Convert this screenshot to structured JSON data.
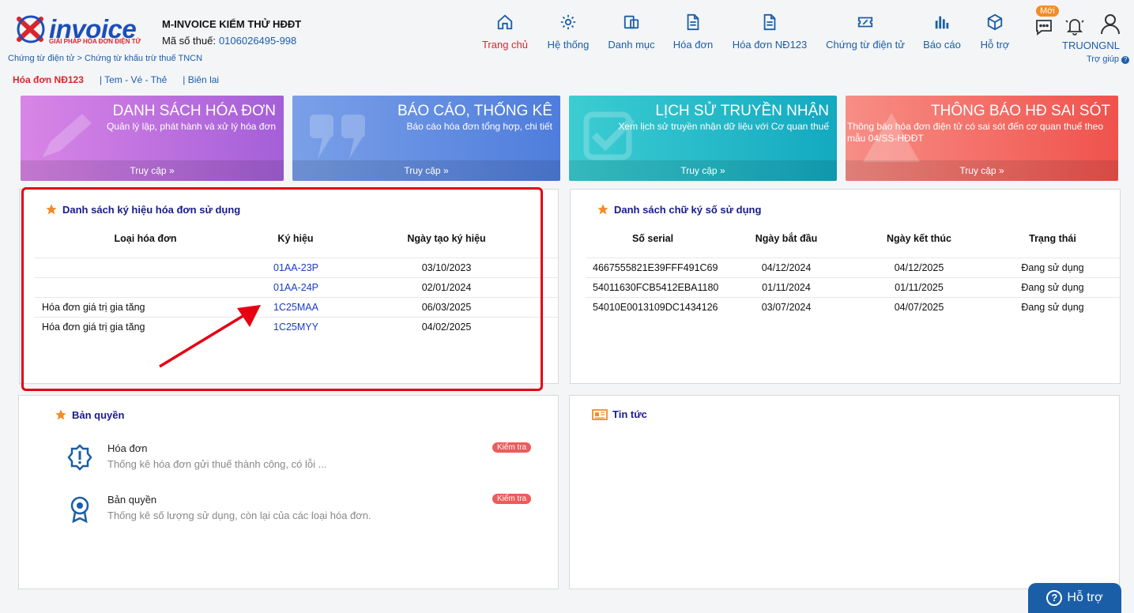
{
  "header": {
    "logo_text": "invoice",
    "logo_sub": "GIẢI PHÁP HÓA ĐƠN ĐIỆN TỬ",
    "company": "M-INVOICE KIỂM THỬ HĐĐT",
    "tax_label": "Mã số thuế:",
    "tax_value": "0106026495-998",
    "breadcrumb": "Chứng từ điện tử > Chứng từ khấu trừ thuế TNCN",
    "nav": [
      {
        "label": "Trang chủ",
        "icon": "home-icon"
      },
      {
        "label": "Hệ thống",
        "icon": "gear-icon"
      },
      {
        "label": "Danh mục",
        "icon": "folder-icon"
      },
      {
        "label": "Hóa đơn",
        "icon": "document-icon"
      },
      {
        "label": "Hóa đơn NĐ123",
        "icon": "document-icon"
      },
      {
        "label": "Chứng từ điện tử",
        "icon": "ticket-icon"
      },
      {
        "label": "Báo cáo",
        "icon": "bar-chart-icon"
      },
      {
        "label": "Hỗ trợ",
        "icon": "cube-icon"
      }
    ],
    "new_badge": "Mới",
    "username": "TRUONGNL",
    "help_link": "Trợ giúp"
  },
  "subnav": {
    "active": "Hóa đơn NĐ123",
    "items": [
      "| Tem - Vé - Thẻ",
      "| Biên lai"
    ]
  },
  "cards": [
    {
      "title": "DANH SÁCH HÓA ĐƠN",
      "desc": "Quản lý lập, phát hành và xử lý hóa đơn",
      "action": "Truy cập",
      "color": "#b26be0"
    },
    {
      "title": "BÁO CÁO, THỐNG KÊ",
      "desc": "Báo cáo hóa đơn tổng hợp, chi tiết",
      "action": "Truy cập",
      "color": "#5f8de2"
    },
    {
      "title": "LỊCH SỬ TRUYỀN NHẬN",
      "desc": "Xem lịch sử truyền nhận dữ liệu với Cơ quan thuế",
      "action": "Truy cập",
      "color": "#22b6c7"
    },
    {
      "title": "THÔNG BÁO HĐ SAI SÓT",
      "desc": "Thông báo hóa đơn điện tử có sai sót đến cơ quan thuế theo mẫu 04/SS-HĐĐT",
      "action": "Truy cập",
      "color": "#f26a64"
    }
  ],
  "symbols_panel": {
    "title": "Danh sách ký hiệu hóa đơn sử dụng",
    "columns": [
      "Loại hóa đơn",
      "Ký hiệu",
      "Ngày tạo ký hiệu"
    ],
    "rows": [
      {
        "type": "",
        "symbol": "01AA-23P",
        "date": "03/10/2023"
      },
      {
        "type": "",
        "symbol": "01AA-24P",
        "date": "02/01/2024"
      },
      {
        "type": "Hóa đơn giá trị gia tăng",
        "symbol": "1C25MAA",
        "date": "06/03/2025"
      },
      {
        "type": "Hóa đơn giá trị gia tăng",
        "symbol": "1C25MYY",
        "date": "04/02/2025"
      }
    ]
  },
  "signatures_panel": {
    "title": "Danh sách chữ ký số sử dụng",
    "columns": [
      "Số serial",
      "Ngày bắt đầu",
      "Ngày kết thúc",
      "Trạng thái"
    ],
    "rows": [
      {
        "serial": "4667555821E39FFF491C69",
        "start": "04/12/2024",
        "end": "04/12/2025",
        "status": "Đang sử dụng"
      },
      {
        "serial": "54011630FCB5412EBA1180",
        "start": "01/11/2024",
        "end": "01/11/2025",
        "status": "Đang sử dụng"
      },
      {
        "serial": "54010E0013109DC1434126",
        "start": "03/07/2024",
        "end": "04/07/2025",
        "status": "Đang sử dụng"
      }
    ]
  },
  "license_panel": {
    "title": "Bản quyền",
    "items": [
      {
        "title": "Hóa đơn",
        "desc": "Thống kê hóa đơn gửi thuế thành công, có lỗi ...",
        "action": "Kiểm tra"
      },
      {
        "title": "Bản quyền",
        "desc": "Thống kê số lượng sử dụng, còn lại của các loại hóa đơn.",
        "action": "Kiểm tra"
      }
    ]
  },
  "news_panel": {
    "title": "Tin tức"
  },
  "help_button": "Hỗ trợ"
}
